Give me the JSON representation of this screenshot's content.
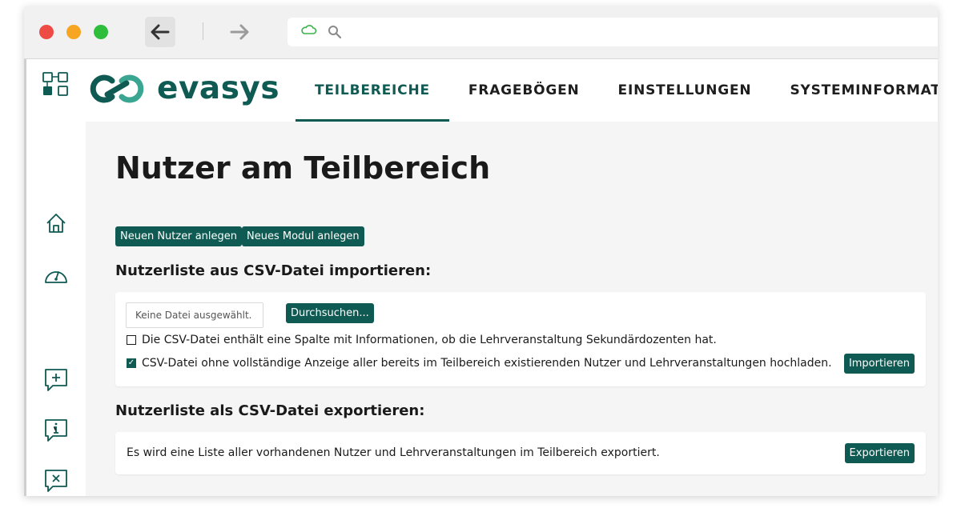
{
  "browser": {
    "back_icon": "arrow-left-icon",
    "forward_icon": "arrow-right-icon",
    "url_icons": [
      "cloud-icon",
      "search-icon"
    ]
  },
  "app": {
    "logo_text": "evasys",
    "tabs": [
      {
        "label": "TEILBEREICHE",
        "active": true
      },
      {
        "label": "FRAGEBÖGEN",
        "active": false
      },
      {
        "label": "EINSTELLUNGEN",
        "active": false
      },
      {
        "label": "SYSTEMINFORMATIONEN",
        "active": false
      }
    ],
    "sidebar_icons": [
      "grid-menu-icon",
      "home-icon",
      "dashboard-gauge-icon",
      "add-comment-icon",
      "info-comment-icon",
      "close-comment-icon"
    ]
  },
  "page": {
    "title": "Nutzer am Teilbereich",
    "new_user_button": "Neuen Nutzer anlegen",
    "new_module_button": "Neues Modul anlegen",
    "import": {
      "heading": "Nutzerliste aus CSV-Datei importieren:",
      "file_placeholder": "Keine Datei ausgewählt.",
      "browse_button": "Durchsuchen...",
      "option1": {
        "label": "Die CSV-Datei enthält eine Spalte mit Informationen, ob die Lehrveranstaltung Sekundärdozenten hat.",
        "checked": false
      },
      "option2": {
        "label": "CSV-Datei ohne vollständige Anzeige aller bereits im Teilbereich existierenden Nutzer und Lehrveranstaltungen hochladen.",
        "checked": true
      },
      "import_button": "Importieren"
    },
    "export": {
      "heading": "Nutzerliste als CSV-Datei exportieren:",
      "description": "Es wird eine Liste aller vorhandenen Nutzer und Lehrveranstaltungen im Teilbereich exportiert.",
      "export_button": "Exportieren"
    }
  },
  "colors": {
    "brand": "#0f5a52",
    "brand_light": "#3aa591",
    "content_bg": "#f5f5f5"
  }
}
